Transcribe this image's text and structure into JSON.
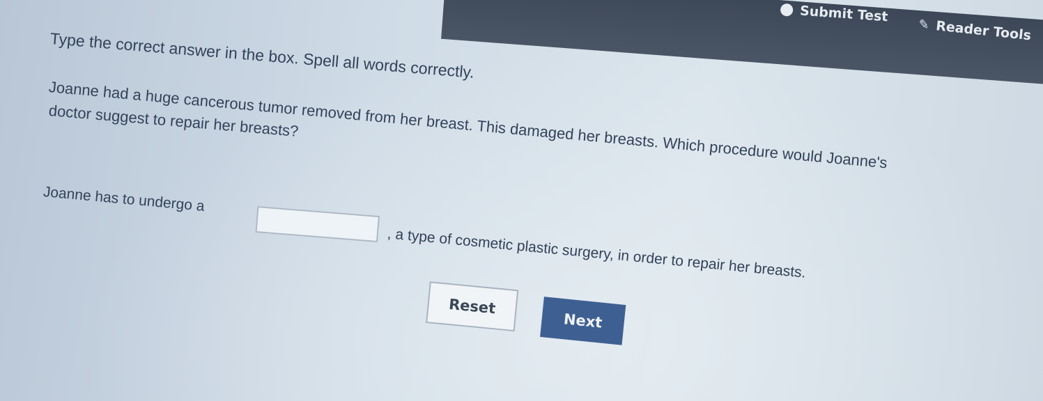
{
  "toolbar": {
    "submit_label": "Submit Test",
    "submit_icon": "circle-dot-icon",
    "reader_label": "Reader Tools",
    "reader_icon": "pen-icon"
  },
  "question": {
    "instruction": "Type the correct answer in the box. Spell all words correctly.",
    "text_line1": "Joanne had a huge cancerous tumor removed from her breast. This damaged her breasts. Which procedure would Joanne's",
    "text_line2": "doctor suggest to repair her breasts?"
  },
  "answer": {
    "prefix": "Joanne has to undergo a",
    "suffix": ", a type of cosmetic plastic surgery, in order to repair her breasts.",
    "input_value": "",
    "input_placeholder": ""
  },
  "buttons": {
    "reset_label": "Reset",
    "next_label": "Next"
  },
  "colors": {
    "toolbar_bg": "#3c4757",
    "next_button_bg": "#3e5f92"
  }
}
